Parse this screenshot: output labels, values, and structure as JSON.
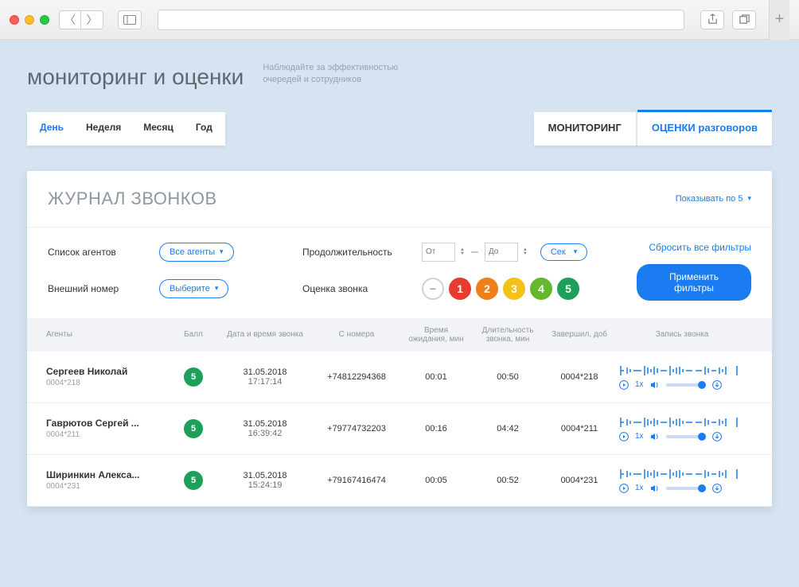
{
  "header": {
    "title": "мониторинг и оценки",
    "subtitle": "Наблюдайте за эффективностью очередей и сотрудников"
  },
  "period_tabs": [
    "День",
    "Неделя",
    "Месяц",
    "Год"
  ],
  "view_tabs": [
    "МОНИТОРИНГ",
    "ОЦЕНКИ разговоров"
  ],
  "journal": {
    "title": "ЖУРНАЛ ЗВОНКОВ",
    "pager_label": "Показывать по 5"
  },
  "filters": {
    "agents_label": "Список агентов",
    "agents_value": "Все агенты",
    "duration_label": "Продолжительность",
    "from_label": "От",
    "to_label": "До",
    "unit_label": "Сек",
    "ext_label": "Внешний номер",
    "ext_value": "Выберите",
    "rating_label": "Оценка звонка",
    "reset_label": "Сбросить все фильтры",
    "apply_label": "Применить фильтры",
    "minus": "−"
  },
  "columns": {
    "agents": "Агенты",
    "score": "Балл",
    "datetime": "Дата и время звонка",
    "from": "С номера",
    "wait": "Время ожидания, мин",
    "dur": "Длительность звонка, мин",
    "ended": "Завершил, доб",
    "rec": "Запись звонка"
  },
  "playback_speed": "1x",
  "rows": [
    {
      "name": "Сергеев Николай",
      "ext": "0004*218",
      "score": "5",
      "date": "31.05.2018",
      "time": "17:17:14",
      "from": "+74812294368",
      "wait": "00:01",
      "dur": "00:50",
      "ended": "0004*218"
    },
    {
      "name": "Гаврютов Сергей ...",
      "ext": "0004*211",
      "score": "5",
      "date": "31.05.2018",
      "time": "16:39:42",
      "from": "+79774732203",
      "wait": "00:16",
      "dur": "04:42",
      "ended": "0004*211"
    },
    {
      "name": "Ширинкин Алекса...",
      "ext": "0004*231",
      "score": "5",
      "date": "31.05.2018",
      "time": "15:24:19",
      "from": "+79167416474",
      "wait": "00:05",
      "dur": "00:52",
      "ended": "0004*231"
    }
  ]
}
